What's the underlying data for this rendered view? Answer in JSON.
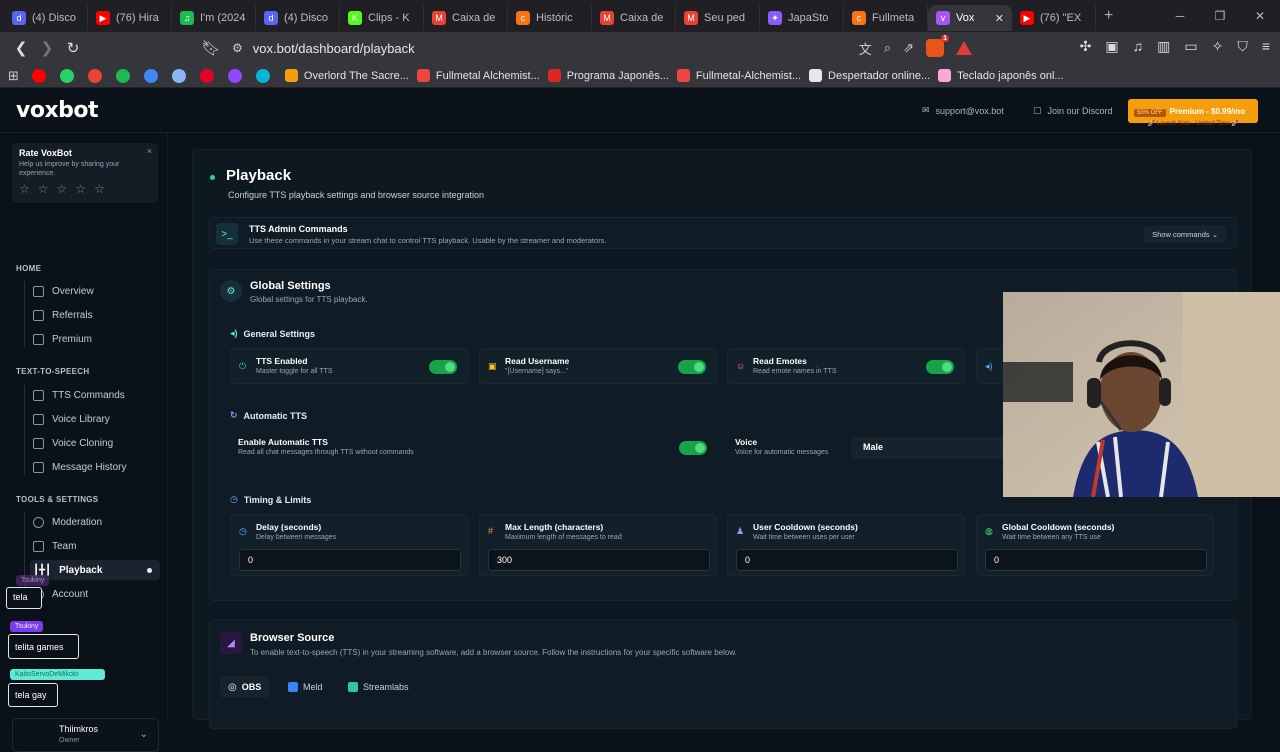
{
  "browser": {
    "tabs": [
      {
        "title": "(4) Disco",
        "fav_color": "#5865f2",
        "fav_glyph": "d"
      },
      {
        "title": "(76) Hira",
        "fav_color": "#ff0000",
        "fav_glyph": "▶"
      },
      {
        "title": "I'm (2024",
        "fav_color": "#1db954",
        "fav_glyph": "♫"
      },
      {
        "title": "(4) Disco",
        "fav_color": "#5865f2",
        "fav_glyph": "d"
      },
      {
        "title": "Clips - K",
        "fav_color": "#53fc18",
        "fav_glyph": "K"
      },
      {
        "title": "Caixa de",
        "fav_color": "#ea4335",
        "fav_glyph": "M"
      },
      {
        "title": "Históric",
        "fav_color": "#f97316",
        "fav_glyph": "c"
      },
      {
        "title": "Caixa de",
        "fav_color": "#ea4335",
        "fav_glyph": "M"
      },
      {
        "title": "Seu ped",
        "fav_color": "#ea4335",
        "fav_glyph": "M"
      },
      {
        "title": "JapaSto",
        "fav_color": "#8b5cf6",
        "fav_glyph": "✦"
      },
      {
        "title": "Fullmeta",
        "fav_color": "#f97316",
        "fav_glyph": "c"
      },
      {
        "title": "Vox",
        "fav_color": "#a855f7",
        "fav_glyph": "v",
        "active": true
      },
      {
        "title": "(76) \"EX",
        "fav_color": "#ff0000",
        "fav_glyph": "▶"
      }
    ],
    "url": "vox.bot/dashboard/playback",
    "brave_badge": "1",
    "bookmarks": [
      {
        "label": "Overlord The Sacre...",
        "color": "#f59e0b"
      },
      {
        "label": "Fullmetal Alchemist...",
        "color": "#ef4444"
      },
      {
        "label": "Programa Japonês...",
        "color": "#dc2626"
      },
      {
        "label": "Fullmetal-Alchemist...",
        "color": "#ef4444"
      },
      {
        "label": "Despertador online...",
        "color": "#e5e7eb"
      },
      {
        "label": "Teclado japonês onl...",
        "color": "#f9a8d4"
      }
    ],
    "bookmark_icons": [
      "#ff0000",
      "#25d366",
      "#ea4335",
      "#1db954",
      "#4285f4",
      "#8ab4f8",
      "#e60023",
      "#9146ff",
      "#06b6d4"
    ]
  },
  "header": {
    "logo": "voxbot",
    "support": "support@vox.bot",
    "discord": "Join our Discord",
    "premium_tag": "50% OFF",
    "premium_label": "Premium - $0.99/mo",
    "premium_sub": "🚀 Launch Sale - Limited Time 🚀"
  },
  "sidebar": {
    "rate_title": "Rate VoxBot",
    "rate_sub": "Help us improve by sharing your experience.",
    "close": "×",
    "stars": [
      "☆",
      "☆",
      "☆",
      "☆",
      "☆"
    ],
    "sections": {
      "home": "HOME",
      "tts": "TEXT-TO-SPEECH",
      "tools": "TOOLS & SETTINGS"
    },
    "home_items": [
      "Overview",
      "Referrals",
      "Premium"
    ],
    "tts_items": [
      "TTS Commands",
      "Voice Library",
      "Voice Cloning",
      "Message History"
    ],
    "tools_items": [
      "Moderation",
      "Team",
      "Playback",
      "Account"
    ],
    "user_name": "Thiimkros",
    "user_role": "Owner"
  },
  "overlays": {
    "tag1": "Tsukiny",
    "box1": "tela",
    "tag2": "Tsukiny",
    "box2": "telita games",
    "tag3": "KaitoServoDeMikoto",
    "box3": "tela gay"
  },
  "main": {
    "title": "Playback",
    "subtitle": "Configure TTS playback settings and browser source integration",
    "admin_title": "TTS Admin Commands",
    "admin_sub": "Use these commands in your stream chat to control TTS playback. Usable by the streamer and moderators.",
    "show_commands": "Show commands ⌄",
    "global_title": "Global Settings",
    "global_sub": "Global settings for TTS playback.",
    "general_head": "General Settings",
    "general_tiles": [
      {
        "title": "TTS Enabled",
        "sub": "Master toggle for all TTS",
        "icon": "⏻",
        "color": "#22d3a5"
      },
      {
        "title": "Read Username",
        "sub": "\"[Username] says...\"",
        "icon": "▣",
        "color": "#facc15"
      },
      {
        "title": "Read Emotes",
        "sub": "Read emote names in TTS",
        "icon": "☺",
        "color": "#f472b6"
      }
    ],
    "auto_head": "Automatic TTS",
    "auto_title": "Enable Automatic TTS",
    "auto_sub": "Read all chat messages through TTS without commands",
    "voice_title": "Voice",
    "voice_sub": "Voice for automatic messages",
    "voice_value": "Male",
    "timing_head": "Timing & Limits",
    "timing_tiles": [
      {
        "title": "Delay (seconds)",
        "sub": "Delay between messages",
        "value": "0",
        "icon": "◷",
        "color": "#60a5fa"
      },
      {
        "title": "Max Length (characters)",
        "sub": "Maximum length of messages to read",
        "value": "300",
        "icon": "#",
        "color": "#fb923c"
      },
      {
        "title": "User Cooldown (seconds)",
        "sub": "Wait time between uses per user",
        "value": "0",
        "icon": "♟",
        "color": "#a78bfa"
      },
      {
        "title": "Global Cooldown (seconds)",
        "sub": "Wait time between any TTS use",
        "value": "0",
        "icon": "◍",
        "color": "#4ade80"
      }
    ],
    "browser_title": "Browser Source",
    "browser_sub": "To enable text-to-speech (TTS) in your streaming software, add a browser source. Follow the instructions for your specific software below.",
    "source_tabs": [
      "OBS",
      "Meld",
      "Streamlabs"
    ]
  }
}
